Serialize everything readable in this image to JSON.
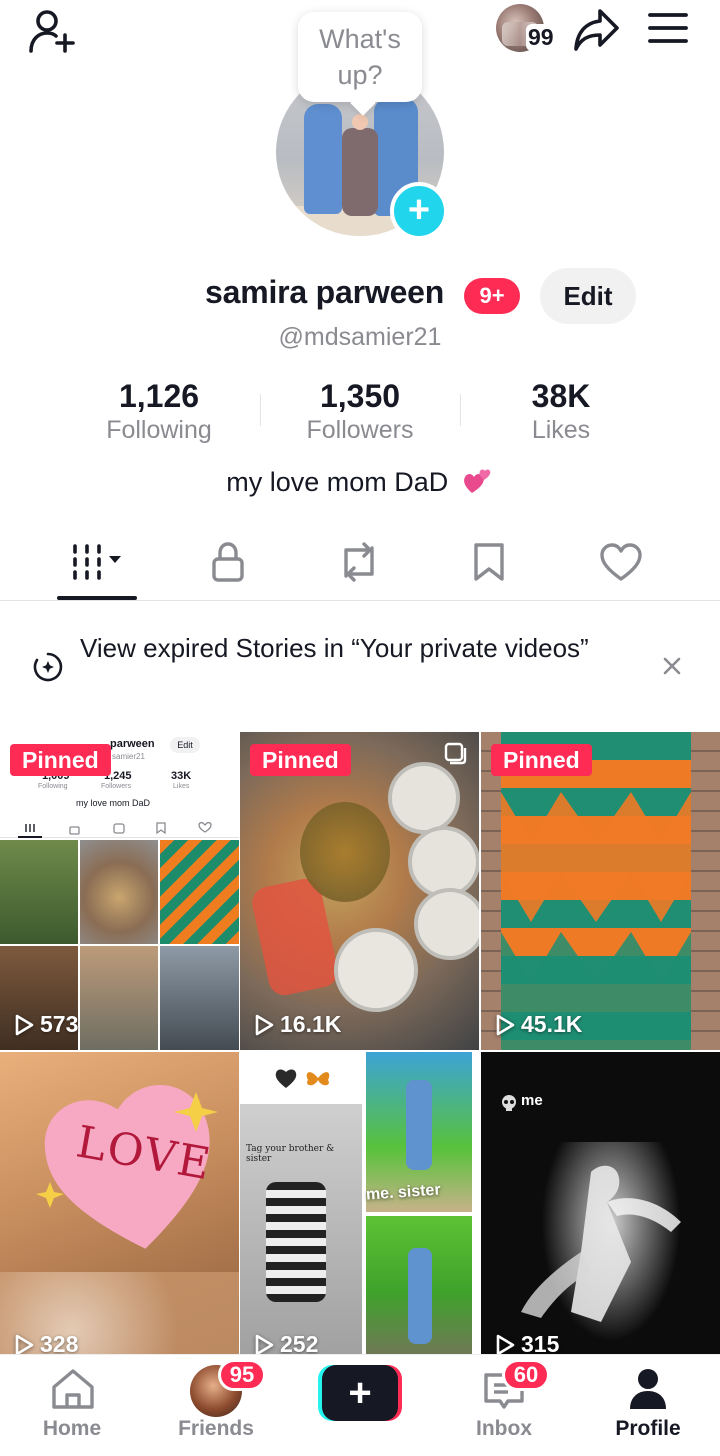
{
  "speech_bubble": {
    "text": "What's up?"
  },
  "header": {
    "story_count": "99"
  },
  "profile": {
    "name": "samira parween",
    "notification_badge": "9+",
    "edit_label": "Edit",
    "handle": "@mdsamier21",
    "bio": "my love mom DaD",
    "stats": [
      {
        "value": "1,126",
        "label": "Following"
      },
      {
        "value": "1,350",
        "label": "Followers"
      },
      {
        "value": "38K",
        "label": "Likes"
      }
    ]
  },
  "tabs": [
    "videos-grid",
    "private",
    "reposts",
    "favorites",
    "liked"
  ],
  "expired_stories": {
    "text": "View expired Stories in “Your private videos”"
  },
  "videos": [
    {
      "pinned": "Pinned",
      "views": "573",
      "thumb_text": "parween",
      "thumb_stats": [
        "1,009",
        "1,245",
        "33K"
      ],
      "thumb_stat_labels": [
        "Following",
        "Followers",
        "Likes"
      ],
      "thumb_handle": "samier21",
      "thumb_bio": "my love mom DaD",
      "thumb_edit": "Edit"
    },
    {
      "pinned": "Pinned",
      "views": "16.1K"
    },
    {
      "pinned": "Pinned",
      "views": "45.1K"
    },
    {
      "pinned": "",
      "views": "328",
      "sticker_text": "LOVE"
    },
    {
      "pinned": "",
      "views": "252",
      "overlay_text_1": "Tag your brother & sister",
      "overlay_text_2": "me. sister"
    },
    {
      "pinned": "",
      "views": "315",
      "overlay_text_1": "me"
    }
  ],
  "bottom_nav": {
    "items": [
      {
        "label": "Home"
      },
      {
        "label": "Friends",
        "badge": "95"
      },
      {
        "label": ""
      },
      {
        "label": "Inbox",
        "badge": "60"
      },
      {
        "label": "Profile"
      }
    ]
  },
  "colors": {
    "accent": "#fe2c55",
    "cyan": "#20d5ec",
    "text": "#161823",
    "muted": "#8a8b91"
  }
}
